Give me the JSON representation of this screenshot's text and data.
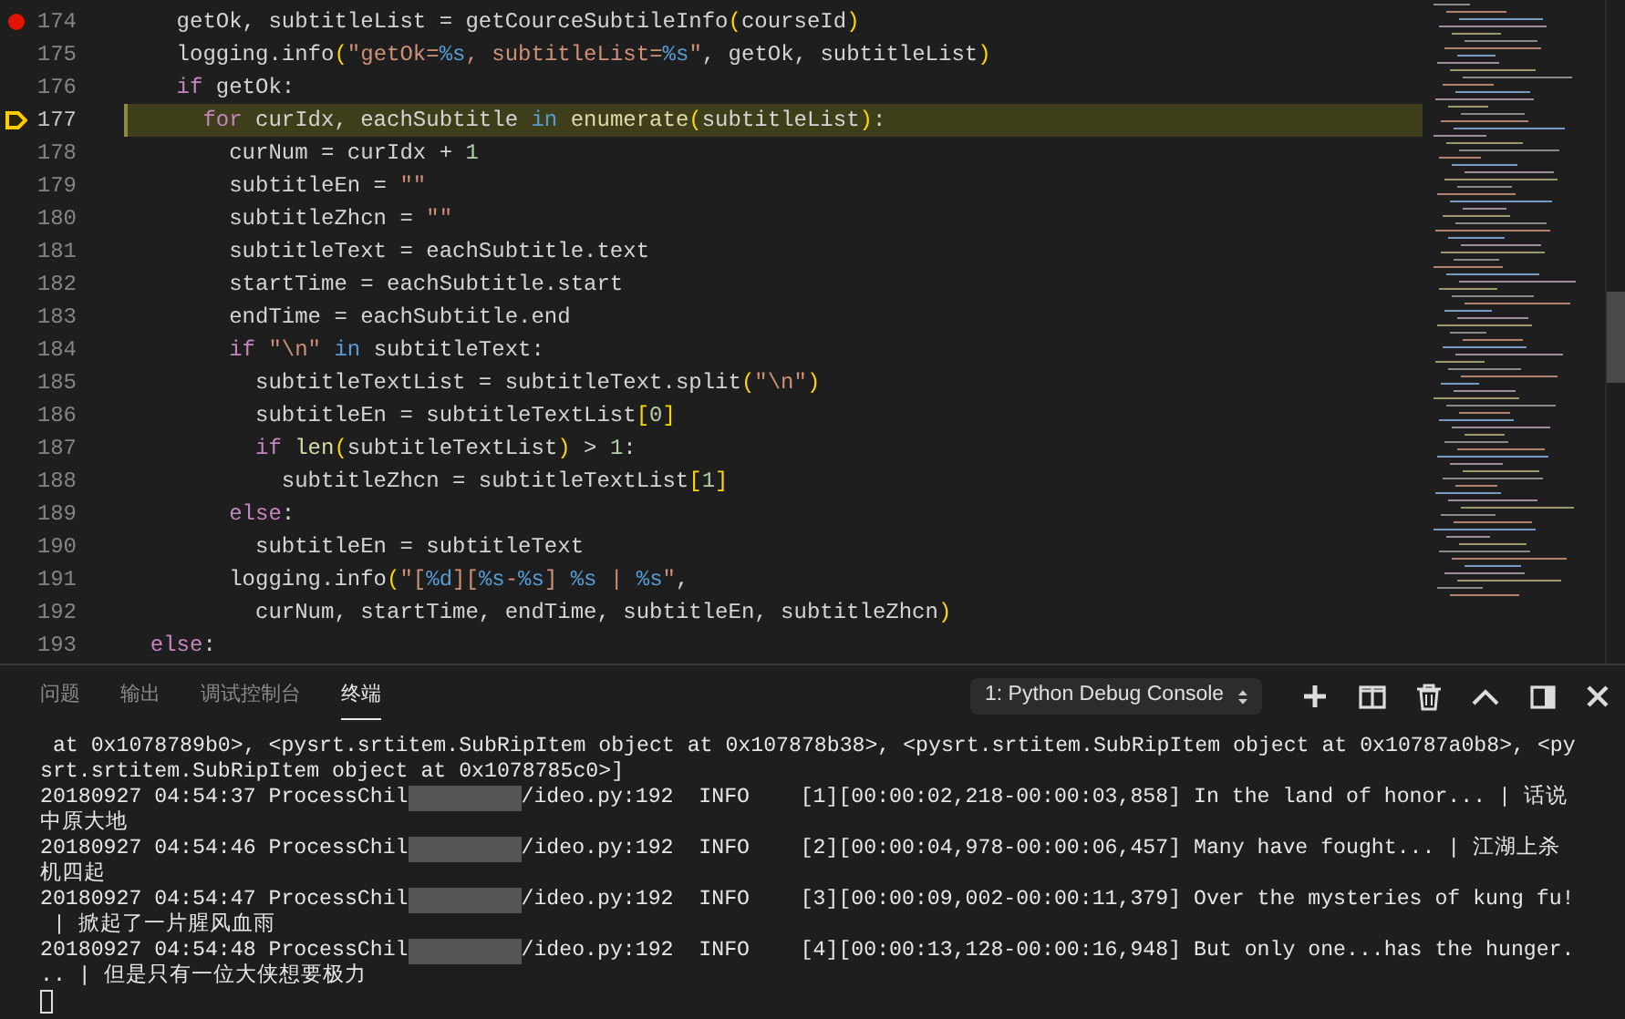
{
  "editor": {
    "lines": [
      {
        "kind": "block",
        "number": "174",
        "breakpoint": true,
        "current": false,
        "tokens": [
          {
            "kind": "plain",
            "text": "getOk, subtitleList = getCourceSubtileInfo"
          },
          {
            "kind": "paren",
            "text": "("
          },
          {
            "kind": "plain",
            "text": "courseId"
          },
          {
            "kind": "paren",
            "text": ")"
          }
        ]
      },
      {
        "kind": "block",
        "number": "175",
        "breakpoint": false,
        "current": false,
        "tokens": [
          {
            "kind": "plain",
            "text": "logging.info"
          },
          {
            "kind": "paren",
            "text": "("
          },
          {
            "kind": "string",
            "text": "\"getOk="
          },
          {
            "kind": "format",
            "text": "%s"
          },
          {
            "kind": "string",
            "text": ", subtitleList="
          },
          {
            "kind": "format",
            "text": "%s"
          },
          {
            "kind": "string",
            "text": "\""
          },
          {
            "kind": "plain",
            "text": ", getOk, subtitleList"
          },
          {
            "kind": "paren",
            "text": ")"
          }
        ]
      },
      {
        "kind": "block",
        "number": "176",
        "breakpoint": false,
        "current": false,
        "tokens": [
          {
            "kind": "keyword",
            "text": "if"
          },
          {
            "kind": "plain",
            "text": " getOk:"
          }
        ],
        "children": [
          {
            "number": "177",
            "breakpoint": false,
            "current": true,
            "tokens": [
              {
                "kind": "keyword",
                "text": "for"
              },
              {
                "kind": "plain",
                "text": " curIdx, eachSubtitle "
              },
              {
                "kind": "operator",
                "text": "in"
              },
              {
                "kind": "func",
                "text": " enumerate"
              },
              {
                "kind": "paren",
                "text": "("
              },
              {
                "kind": "plain",
                "text": "subtitleList"
              },
              {
                "kind": "paren",
                "text": ")"
              },
              {
                "kind": "plain",
                "text": ":"
              }
            ],
            "children": [
              {
                "number": "178",
                "breakpoint": false,
                "current": false,
                "tokens": [
                  {
                    "kind": "plain",
                    "text": "curNum = curIdx + "
                  },
                  {
                    "kind": "number",
                    "text": "1"
                  }
                ]
              },
              {
                "number": "179",
                "breakpoint": false,
                "current": false,
                "tokens": [
                  {
                    "kind": "plain",
                    "text": "subtitleEn = "
                  },
                  {
                    "kind": "string",
                    "text": "\"\""
                  }
                ]
              },
              {
                "number": "180",
                "breakpoint": false,
                "current": false,
                "tokens": [
                  {
                    "kind": "plain",
                    "text": "subtitleZhcn = "
                  },
                  {
                    "kind": "string",
                    "text": "\"\""
                  }
                ]
              },
              {
                "number": "181",
                "breakpoint": false,
                "current": false,
                "tokens": [
                  {
                    "kind": "plain",
                    "text": "subtitleText = eachSubtitle.text"
                  }
                ]
              },
              {
                "number": "182",
                "breakpoint": false,
                "current": false,
                "tokens": [
                  {
                    "kind": "plain",
                    "text": "startTime = eachSubtitle.start"
                  }
                ]
              },
              {
                "number": "183",
                "breakpoint": false,
                "current": false,
                "tokens": [
                  {
                    "kind": "plain",
                    "text": "endTime = eachSubtitle.end"
                  }
                ]
              },
              {
                "number": "184",
                "breakpoint": false,
                "current": false,
                "tokens": [
                  {
                    "kind": "keyword",
                    "text": "if"
                  },
                  {
                    "kind": "string",
                    "text": " \"\\n\""
                  },
                  {
                    "kind": "operator",
                    "text": " in"
                  },
                  {
                    "kind": "plain",
                    "text": " subtitleText:"
                  }
                ],
                "children": [
                  {
                    "number": "185",
                    "breakpoint": false,
                    "current": false,
                    "tokens": [
                      {
                        "kind": "plain",
                        "text": "subtitleTextList = subtitleText.split"
                      },
                      {
                        "kind": "paren",
                        "text": "("
                      },
                      {
                        "kind": "string",
                        "text": "\"\\n\""
                      },
                      {
                        "kind": "paren",
                        "text": ")"
                      }
                    ]
                  },
                  {
                    "number": "186",
                    "breakpoint": false,
                    "current": false,
                    "tokens": [
                      {
                        "kind": "plain",
                        "text": "subtitleEn = subtitleTextList"
                      },
                      {
                        "kind": "paren",
                        "text": "["
                      },
                      {
                        "kind": "number",
                        "text": "0"
                      },
                      {
                        "kind": "paren",
                        "text": "]"
                      }
                    ]
                  },
                  {
                    "number": "187",
                    "breakpoint": false,
                    "current": false,
                    "tokens": [
                      {
                        "kind": "keyword",
                        "text": "if"
                      },
                      {
                        "kind": "func",
                        "text": " len"
                      },
                      {
                        "kind": "paren",
                        "text": "("
                      },
                      {
                        "kind": "plain",
                        "text": "subtitleTextList"
                      },
                      {
                        "kind": "paren",
                        "text": ")"
                      },
                      {
                        "kind": "plain",
                        "text": " > "
                      },
                      {
                        "kind": "number",
                        "text": "1"
                      },
                      {
                        "kind": "plain",
                        "text": ":"
                      }
                    ],
                    "children": [
                      {
                        "number": "188",
                        "breakpoint": false,
                        "current": false,
                        "tokens": [
                          {
                            "kind": "plain",
                            "text": "subtitleZhcn = subtitleTextList"
                          },
                          {
                            "kind": "paren",
                            "text": "["
                          },
                          {
                            "kind": "number",
                            "text": "1"
                          },
                          {
                            "kind": "paren",
                            "text": "]"
                          }
                        ]
                      }
                    ]
                  }
                ]
              },
              {
                "number": "189",
                "breakpoint": false,
                "current": false,
                "tokens": [
                  {
                    "kind": "keyword",
                    "text": "else"
                  },
                  {
                    "kind": "plain",
                    "text": ":"
                  }
                ],
                "children": [
                  {
                    "number": "190",
                    "breakpoint": false,
                    "current": false,
                    "tokens": [
                      {
                        "kind": "plain",
                        "text": "subtitleEn = subtitleText"
                      }
                    ]
                  }
                ]
              },
              {
                "number": "191",
                "breakpoint": false,
                "current": false,
                "tokens": [
                  {
                    "kind": "plain",
                    "text": "logging.info"
                  },
                  {
                    "kind": "paren",
                    "text": "("
                  },
                  {
                    "kind": "string",
                    "text": "\"["
                  },
                  {
                    "kind": "format",
                    "text": "%d"
                  },
                  {
                    "kind": "string",
                    "text": "]["
                  },
                  {
                    "kind": "format",
                    "text": "%s"
                  },
                  {
                    "kind": "string",
                    "text": "-"
                  },
                  {
                    "kind": "format",
                    "text": "%s"
                  },
                  {
                    "kind": "string",
                    "text": "] "
                  },
                  {
                    "kind": "format",
                    "text": "%s"
                  },
                  {
                    "kind": "string",
                    "text": " | "
                  },
                  {
                    "kind": "format",
                    "text": "%s"
                  },
                  {
                    "kind": "string",
                    "text": "\""
                  },
                  {
                    "kind": "plain",
                    "text": ","
                  }
                ],
                "children": [
                  {
                    "number": "192",
                    "breakpoint": false,
                    "current": false,
                    "tokens": [
                      {
                        "kind": "plain",
                        "text": "curNum, startTime, endTime, subtitleEn, subtitleZhcn"
                      },
                      {
                        "kind": "paren",
                        "text": ")"
                      }
                    ]
                  }
                ]
              }
            ]
          }
        ]
      },
      {
        "kind": "outer",
        "number": "193",
        "breakpoint": false,
        "current": false,
        "tokens": [
          {
            "kind": "keyword",
            "text": "else"
          },
          {
            "kind": "plain",
            "text": ":"
          }
        ]
      }
    ]
  },
  "panel": {
    "tabs": [
      {
        "label": "问题",
        "selected": false
      },
      {
        "label": "输出",
        "selected": false
      },
      {
        "label": "调试控制台",
        "selected": false
      },
      {
        "label": "终端",
        "selected": true
      }
    ],
    "terminal_select": "1: Python Debug Console",
    "terminal": [
      {
        "kind": "text",
        "text": " at 0x1078789b0>, <pysrt.srtitem.SubRipItem object at 0x107878b38>, <pysrt.srtitem.SubRipItem object at 0x10787a0b8>, <py"
      },
      {
        "kind": "text",
        "text": "srt.srtitem.SubRipItem object at 0x1078785c0>]"
      },
      {
        "kind": "log",
        "before": "20180927 04:54:37 ProcessChil",
        "after": "/ideo.py:192  INFO    [1][00:00:02,218-00:00:03,858] In the land of honor... | 话说"
      },
      {
        "kind": "text",
        "text": "中原大地"
      },
      {
        "kind": "log",
        "before": "20180927 04:54:46 ProcessChil",
        "after": "/ideo.py:192  INFO    [2][00:00:04,978-00:00:06,457] Many have fought... | 江湖上杀"
      },
      {
        "kind": "text",
        "text": "机四起"
      },
      {
        "kind": "log",
        "before": "20180927 04:54:47 ProcessChil",
        "after": "/ideo.py:192  INFO    [3][00:00:09,002-00:00:11,379] Over the mysteries of kung fu!"
      },
      {
        "kind": "text",
        "text": " | 掀起了一片腥风血雨"
      },
      {
        "kind": "log",
        "before": "20180927 04:54:48 ProcessChil",
        "after": "/ideo.py:192  INFO    [4][00:00:13,128-00:00:16,948] But only one...has the hunger."
      },
      {
        "kind": "text",
        "text": ".. | 但是只有一位大侠想要极力"
      },
      {
        "kind": "cursor"
      }
    ]
  }
}
